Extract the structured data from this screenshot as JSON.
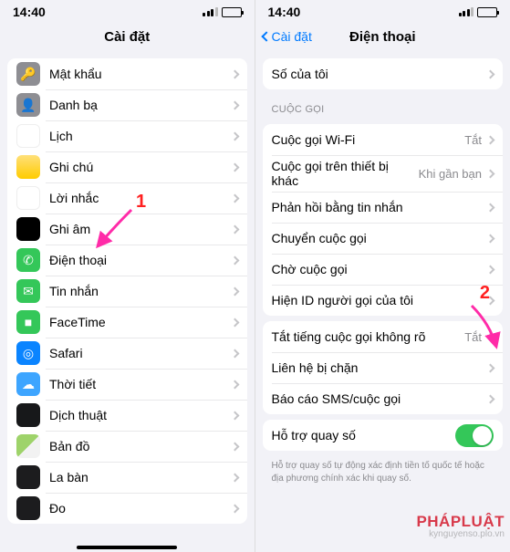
{
  "status": {
    "time": "14:40"
  },
  "left": {
    "title": "Cài đặt",
    "items": [
      {
        "label": "Mật khẩu",
        "icon": "ic-key",
        "iconName": "key-icon",
        "glyph": "🔑"
      },
      {
        "label": "Danh bạ",
        "icon": "ic-contacts",
        "iconName": "contacts-icon",
        "glyph": "👤"
      },
      {
        "label": "Lịch",
        "icon": "ic-cal",
        "iconName": "calendar-icon",
        "glyph": ""
      },
      {
        "label": "Ghi chú",
        "icon": "ic-notes",
        "iconName": "notes-icon",
        "glyph": ""
      },
      {
        "label": "Lời nhắc",
        "icon": "ic-remind",
        "iconName": "reminders-icon",
        "glyph": ""
      },
      {
        "label": "Ghi âm",
        "icon": "ic-voice",
        "iconName": "voice-memos-icon",
        "glyph": ""
      },
      {
        "label": "Điện thoại",
        "icon": "ic-phone",
        "iconName": "phone-icon",
        "glyph": "✆"
      },
      {
        "label": "Tin nhắn",
        "icon": "ic-msg",
        "iconName": "messages-icon",
        "glyph": "✉"
      },
      {
        "label": "FaceTime",
        "icon": "ic-ft",
        "iconName": "facetime-icon",
        "glyph": "■"
      },
      {
        "label": "Safari",
        "icon": "ic-safari",
        "iconName": "safari-icon",
        "glyph": "◎"
      },
      {
        "label": "Thời tiết",
        "icon": "ic-weather",
        "iconName": "weather-icon",
        "glyph": "☁"
      },
      {
        "label": "Dịch thuật",
        "icon": "ic-translate",
        "iconName": "translate-icon",
        "glyph": ""
      },
      {
        "label": "Bản đồ",
        "icon": "ic-maps",
        "iconName": "maps-icon",
        "glyph": ""
      },
      {
        "label": "La bàn",
        "icon": "ic-compass",
        "iconName": "compass-icon",
        "glyph": ""
      },
      {
        "label": "Đo",
        "icon": "ic-measure",
        "iconName": "measure-icon",
        "glyph": ""
      }
    ]
  },
  "right": {
    "back": "Cài đặt",
    "title": "Điện thoại",
    "g1": [
      {
        "label": "Số của tôi"
      }
    ],
    "sec_header": "CUỘC GỌI",
    "g2": [
      {
        "label": "Cuộc gọi Wi-Fi",
        "value": "Tắt"
      },
      {
        "label": "Cuộc gọi trên thiết bị khác",
        "value": "Khi gần bạn"
      },
      {
        "label": "Phản hồi bằng tin nhắn"
      },
      {
        "label": "Chuyển cuộc gọi"
      },
      {
        "label": "Chờ cuộc gọi"
      },
      {
        "label": "Hiện ID người gọi của tôi"
      }
    ],
    "g3": [
      {
        "label": "Tắt tiếng cuộc gọi không rõ",
        "value": "Tắt"
      },
      {
        "label": "Liên hệ bị chặn"
      },
      {
        "label": "Báo cáo SMS/cuộc gọi"
      }
    ],
    "g4": [
      {
        "label": "Hỗ trợ quay số"
      }
    ],
    "foot": "Hỗ trợ quay số tự động xác định tiền tố quốc tế hoặc địa phương chính xác khi quay số."
  },
  "ann": {
    "n1": "1",
    "n2": "2"
  },
  "wm": {
    "brand": "PHÁPLUẬT",
    "url": "kynguyenso.plo.vn"
  }
}
